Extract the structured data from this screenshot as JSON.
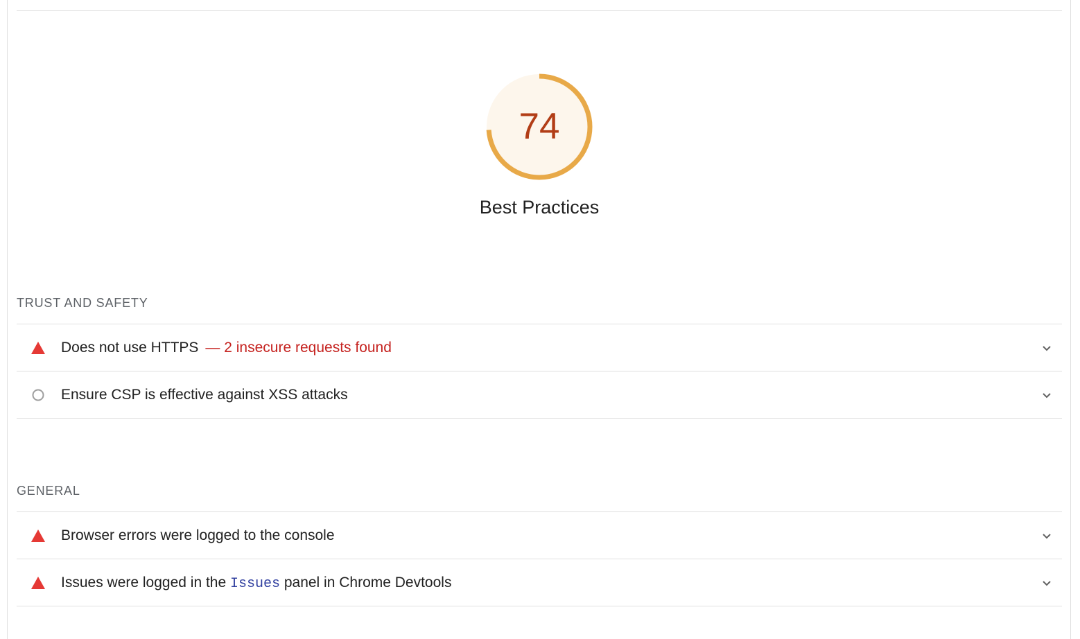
{
  "gauge": {
    "score": "74",
    "score_fraction": 0.74,
    "label": "Best Practices",
    "colors": {
      "arc": "#e8a948",
      "fill": "#fdf6ec",
      "text": "#b23d16"
    }
  },
  "groups": [
    {
      "title": "TRUST AND SAFETY",
      "audits": [
        {
          "status": "fail",
          "icon": "warning-triangle-icon",
          "title": "Does not use HTTPS",
          "display": "— 2 insecure requests found"
        },
        {
          "status": "manual",
          "icon": "circle-outline-icon",
          "title": "Ensure CSP is effective against XSS attacks"
        }
      ]
    },
    {
      "title": "GENERAL",
      "audits": [
        {
          "status": "fail",
          "icon": "warning-triangle-icon",
          "title": "Browser errors were logged to the console"
        },
        {
          "status": "fail",
          "icon": "warning-triangle-icon",
          "title_before": "Issues were logged in the ",
          "title_code": "Issues",
          "title_after": " panel in Chrome Devtools"
        }
      ]
    }
  ],
  "colors": {
    "fail": "#e53935",
    "manual": "#9e9e9e",
    "display_text": "#c5221f",
    "code_text": "#303f9f"
  }
}
